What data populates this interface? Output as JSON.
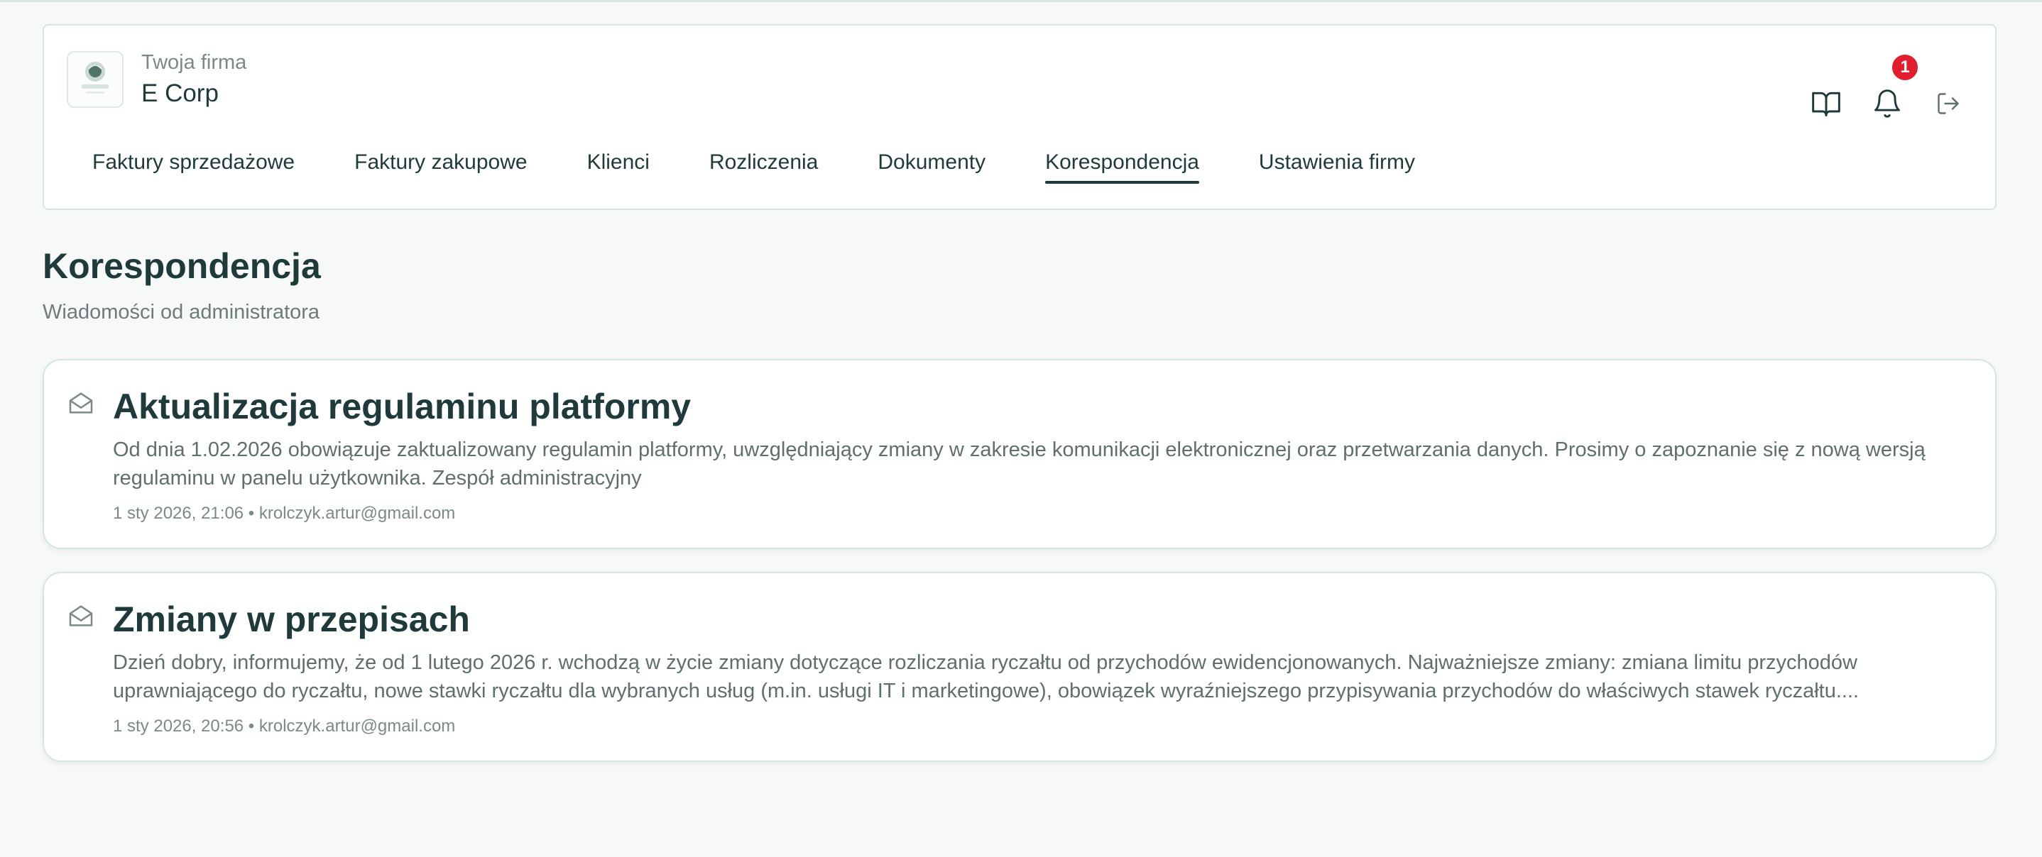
{
  "header": {
    "company_label": "Twoja firma",
    "company_name": "E Corp",
    "logo_text": "JAPCOATIC",
    "notifications_count": "1",
    "icons": {
      "docs": "book-open-icon",
      "notifications": "bell-icon",
      "logout": "logout-icon"
    }
  },
  "nav": {
    "tabs": [
      {
        "label": "Faktury sprzedażowe"
      },
      {
        "label": "Faktury zakupowe"
      },
      {
        "label": "Klienci"
      },
      {
        "label": "Rozliczenia"
      },
      {
        "label": "Dokumenty"
      },
      {
        "label": "Korespondencja",
        "active": true
      },
      {
        "label": "Ustawienia firmy"
      }
    ]
  },
  "page": {
    "title": "Korespondencja",
    "subtitle": "Wiadomości od administratora"
  },
  "messages": [
    {
      "icon": "envelope-open-icon",
      "title": "Aktualizacja regulaminu platformy",
      "body": "Od dnia 1.02.2026 obowiązuje zaktualizowany regulamin platformy, uwzględniający zmiany w zakresie komunikacji elektronicznej oraz przetwarzania danych. Prosimy o zapoznanie się z nową wersją regulaminu w panelu użytkownika. Zespół administracyjny",
      "meta": "1 sty 2026, 21:06 • krolczyk.artur@gmail.com"
    },
    {
      "icon": "envelope-open-icon",
      "title": "Zmiany w przepisach",
      "body": "Dzień dobry, informujemy, że od 1 lutego 2026 r. wchodzą w życie zmiany dotyczące rozliczania ryczałtu od przychodów ewidencjonowanych. Najważniejsze zmiany: zmiana limitu przychodów uprawniającego do ryczałtu, nowe stawki ryczałtu dla wybranych usług (m.in. usługi IT i marketingowe), obowiązek wyraźniejszego przypisywania przychodów do właściwych stawek ryczałtu....",
      "meta": "1 sty 2026, 20:56 • krolczyk.artur@gmail.com"
    }
  ],
  "colors": {
    "text_dark": "#1f3a3a",
    "text_muted": "#6c7b7b",
    "border": "#d4e6e0",
    "badge": "#e11d2e",
    "background": "#f7f9f8"
  }
}
